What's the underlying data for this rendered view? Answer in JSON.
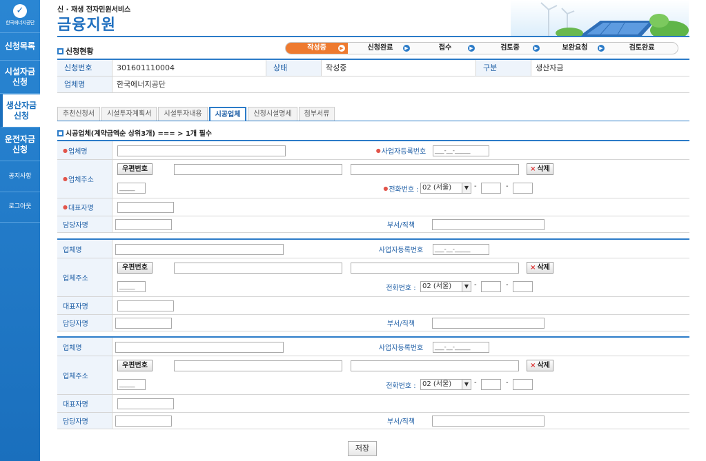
{
  "sidebar": {
    "logo_text": "한국에너지공단",
    "items": [
      {
        "label": "신청목록"
      },
      {
        "label": "시설자금\n신청"
      },
      {
        "label": "생산자금\n신청"
      },
      {
        "label": "운전자금\n신청"
      },
      {
        "label": "공지사항"
      },
      {
        "label": "로그아웃"
      }
    ]
  },
  "header": {
    "subtitle": "신 · 재생 전자민원서비스",
    "title": "금융지원"
  },
  "status": {
    "label": "신청현황",
    "steps": [
      "작성중",
      "신청완료",
      "접수",
      "검토중",
      "보완요청",
      "검토완료"
    ]
  },
  "info": {
    "application_no_label": "신청번호",
    "application_no": "301601110004",
    "state_label": "상태",
    "state": "작성중",
    "category_label": "구분",
    "category": "생산자금",
    "company_label": "업체명",
    "company": "한국에너지공단"
  },
  "tabs": [
    "추천신청서",
    "시설투자계획서",
    "시설투자내용",
    "시공업체",
    "신청시설명세",
    "첨부서류"
  ],
  "section_title": "시공업체(계약금액순 상위3개) === > 1개 필수",
  "form_labels": {
    "company": "업체명",
    "biz_no": "사업자등록번호",
    "address": "업체주소",
    "phone": "전화번호 :",
    "ceo": "대표자명",
    "manager": "담당자명",
    "dept": "부서/직책"
  },
  "buttons": {
    "zip": "우편번호",
    "delete": "삭제",
    "save": "저장"
  },
  "fields": {
    "biz_no_placeholder": "___-__-_____",
    "zip_placeholder": "_____",
    "phone_area": "02 (서울)"
  }
}
